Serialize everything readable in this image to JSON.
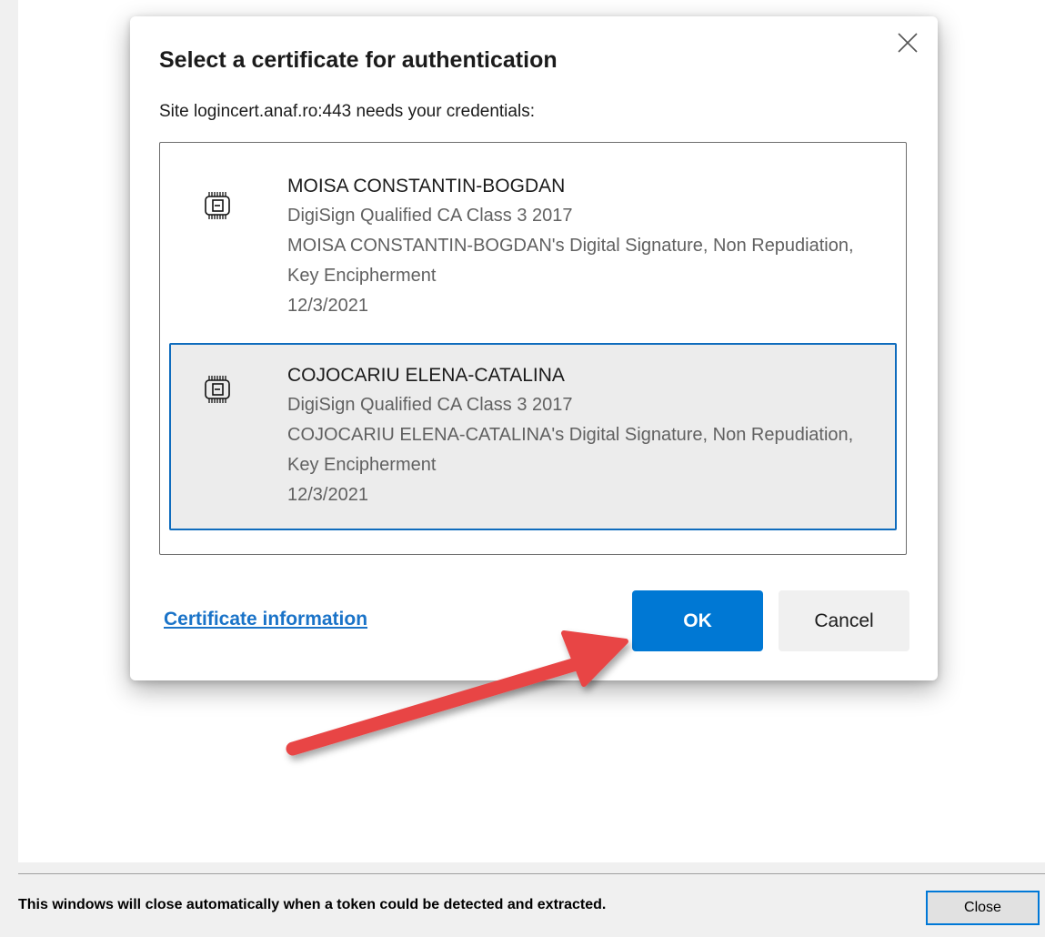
{
  "dialog": {
    "title": "Select a certificate for authentication",
    "subtitle": "Site logincert.anaf.ro:443 needs your credentials:",
    "close_icon": "close-icon",
    "certificates": [
      {
        "name": "MOISA CONSTANTIN-BOGDAN",
        "issuer": "DigiSign Qualified CA Class 3 2017",
        "usage": "MOISA CONSTANTIN-BOGDAN's Digital Signature, Non Repudiation, Key Encipherment",
        "date": "12/3/2021",
        "icon": "certificate-chip-icon",
        "selected": false
      },
      {
        "name": "COJOCARIU ELENA-CATALINA",
        "issuer": "DigiSign Qualified CA Class 3 2017",
        "usage": "COJOCARIU ELENA-CATALINA's Digital Signature, Non Repudiation, Key Encipherment",
        "date": "12/3/2021",
        "icon": "certificate-chip-icon",
        "selected": true
      }
    ],
    "cert_info_link": "Certificate information",
    "ok_label": "OK",
    "cancel_label": "Cancel"
  },
  "window": {
    "status_message": "This windows will close automatically when a token could be detected and extracted.",
    "close_label": "Close"
  },
  "annotation": {
    "arrow_icon": "red-arrow-icon"
  },
  "colors": {
    "accent": "#0078d4",
    "link": "#1a73c8",
    "selected_border": "#0f6cbd",
    "selected_bg": "#ececec",
    "arrow": "#e84545"
  }
}
